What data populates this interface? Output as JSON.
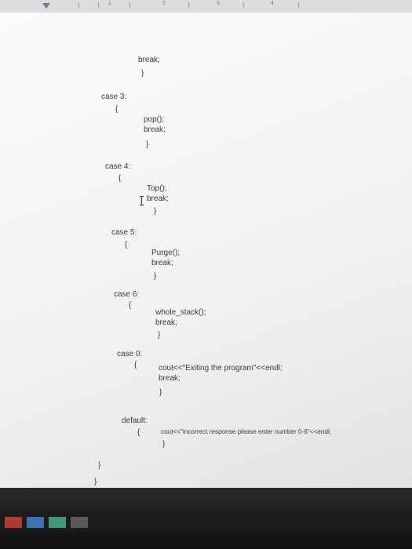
{
  "ruler": {
    "labels": [
      "1",
      "2",
      "3",
      "4"
    ]
  },
  "code": {
    "l1": "break;",
    "l2": "}",
    "l3": "case 3:",
    "l4": "{",
    "l5": "pop();",
    "l6": "break;",
    "l7": "}",
    "l8": "case 4:",
    "l9": "{",
    "l10": "Top();",
    "l11": "break;",
    "l12": "}",
    "l13": "case 5:",
    "l14": "{",
    "l15": "Purge();",
    "l16": "break;",
    "l17": "}",
    "l18": "case 6:",
    "l19": "{",
    "l20": "whole_stack();",
    "l21": "break;",
    "l22": "}",
    "l23": "case 0:",
    "l24": "{",
    "l25": "cout<<\"Exiting the program\"<<endl;",
    "l26": "break;",
    "l27": "}",
    "l28": "default:",
    "l29": "{",
    "l30": "cout<<\"incorrect response please enter number 0-6\"<<endl;",
    "l31": "}",
    "l32": "}",
    "l33": "}"
  }
}
